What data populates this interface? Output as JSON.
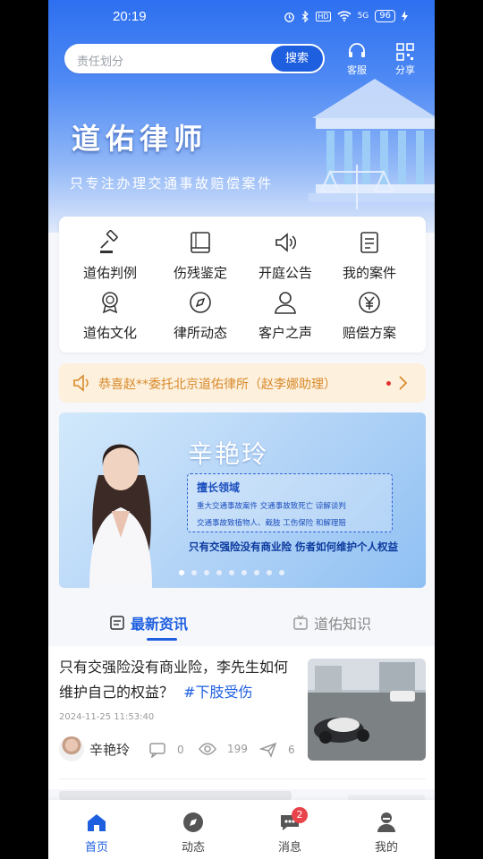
{
  "status_bar": {
    "time": "20:19",
    "network": "5G",
    "hd": "HD",
    "battery": "96"
  },
  "search": {
    "placeholder": "责任划分",
    "button": "搜索"
  },
  "top_actions": {
    "service": "客服",
    "share": "分享"
  },
  "hero": {
    "brand": "道佑律师",
    "slogan": "只专注办理交通事故赔偿案件"
  },
  "menu": {
    "items": [
      {
        "label": "道佑判例",
        "icon": "gavel-icon"
      },
      {
        "label": "伤残鉴定",
        "icon": "book-icon"
      },
      {
        "label": "开庭公告",
        "icon": "speaker-icon"
      },
      {
        "label": "我的案件",
        "icon": "document-icon"
      },
      {
        "label": "道佑文化",
        "icon": "medal-icon"
      },
      {
        "label": "律所动态",
        "icon": "compass-icon"
      },
      {
        "label": "客户之声",
        "icon": "person-icon"
      },
      {
        "label": "赔偿方案",
        "icon": "yen-icon"
      }
    ]
  },
  "notice": {
    "text": "恭喜赵**委托北京道佑律所（赵李娜助理）"
  },
  "banner": {
    "name": "辛艳玲",
    "specialty_title": "擅长领域",
    "specialty_line1": "重大交通事故案件   交通事故致死亡   谅解谈判",
    "specialty_line2": "交通事故致植物人、截肢   工伤保险   和解理赔",
    "tagline": "只有交强险没有商业险 伤者如何维护个人权益",
    "dot_count": 9,
    "active_dot": 1
  },
  "tabs": {
    "latest": "最新资讯",
    "knowledge": "道佑知识"
  },
  "article": {
    "title": "只有交强险没有商业险，李先生如何维护自己的权益？",
    "tag": "#下肢受伤",
    "date": "2024-11-25 11:53:40",
    "author": "辛艳玲",
    "comments": "0",
    "views": "199",
    "shares": "6"
  },
  "bottom_nav": [
    {
      "label": "首页",
      "icon": "home-icon"
    },
    {
      "label": "动态",
      "icon": "compass-icon"
    },
    {
      "label": "消息",
      "icon": "chat-icon",
      "badge": "2"
    },
    {
      "label": "我的",
      "icon": "user-icon"
    }
  ],
  "colors": {
    "primary": "#1e5fe0",
    "notice_text": "#d88a2a",
    "badge": "#e8434a"
  }
}
